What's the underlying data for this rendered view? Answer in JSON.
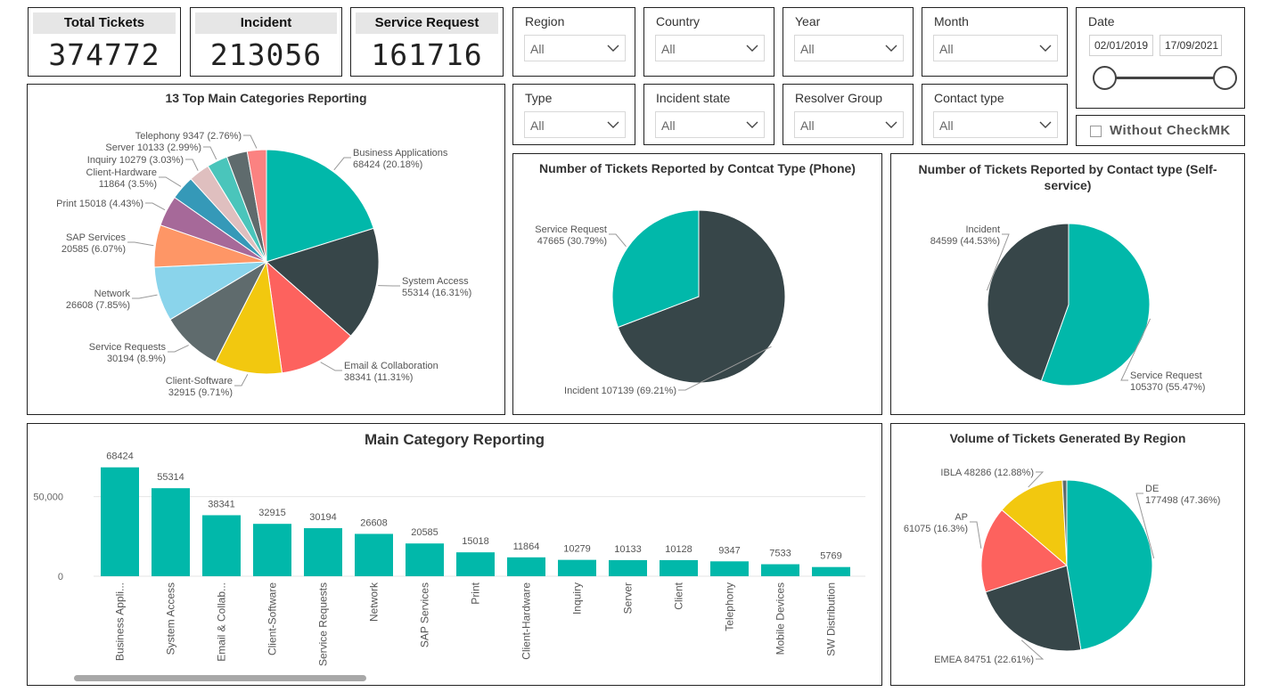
{
  "kpis": [
    {
      "label": "Total  Tickets",
      "value": "374772"
    },
    {
      "label": "Incident",
      "value": "213056"
    },
    {
      "label": "Service Request",
      "value": "161716"
    }
  ],
  "slicers": {
    "region": {
      "label": "Region",
      "value": "All"
    },
    "country": {
      "label": "Country",
      "value": "All"
    },
    "year": {
      "label": "Year",
      "value": "All"
    },
    "month": {
      "label": "Month",
      "value": "All"
    },
    "type": {
      "label": "Type",
      "value": "All"
    },
    "incident_state": {
      "label": "Incident state",
      "value": "All"
    },
    "resolver_group": {
      "label": "Resolver Group",
      "value": "All"
    },
    "contact_type": {
      "label": "Contact type",
      "value": "All"
    }
  },
  "date_slicer": {
    "label": "Date",
    "start": "02/01/2019",
    "end": "17/09/2021",
    "range_fraction": [
      0,
      1
    ]
  },
  "checkbox": {
    "label": "Without CheckMK",
    "checked": false
  },
  "colors": {
    "teal": "#01B8AA",
    "dark": "#374649",
    "red": "#FD625E",
    "yellow": "#F2C80F",
    "gray": "#5F6B6D",
    "lightblue": "#8AD4EB",
    "orange": "#FE9666",
    "purple": "#A66999",
    "blue": "#3599B8",
    "pink": "#DFBFBF",
    "turquoise": "#4AC5BB",
    "darkgray": "#5F6B6D",
    "salmon": "#FB8281"
  },
  "chart_data": [
    {
      "id": "top-categories",
      "type": "pie",
      "title": "13 Top Main Categories Reporting",
      "slices": [
        {
          "label": "Business Applications",
          "value": 68424,
          "pct": "20.18%",
          "color": "#01B8AA"
        },
        {
          "label": "System Access",
          "value": 55314,
          "pct": "16.31%",
          "color": "#374649"
        },
        {
          "label": "Email & Collaboration",
          "value": 38341,
          "pct": "11.31%",
          "color": "#FD625E"
        },
        {
          "label": "Client-Software",
          "value": 32915,
          "pct": "9.71%",
          "color": "#F2C80F"
        },
        {
          "label": "Service Requests",
          "value": 30194,
          "pct": "8.9%",
          "color": "#5F6B6D"
        },
        {
          "label": "Network",
          "value": 26608,
          "pct": "7.85%",
          "color": "#8AD4EB"
        },
        {
          "label": "SAP Services",
          "value": 20585,
          "pct": "6.07%",
          "color": "#FE9666"
        },
        {
          "label": "Print",
          "value": 15018,
          "pct": "4.43%",
          "color": "#A66999"
        },
        {
          "label": "Client-Hardware",
          "value": 11864,
          "pct": "3.5%",
          "color": "#3599B8"
        },
        {
          "label": "Inquiry",
          "value": 10279,
          "pct": "3.03%",
          "color": "#DFBFBF"
        },
        {
          "label": "Server",
          "value": 10133,
          "pct": "2.99%",
          "color": "#4AC5BB"
        },
        {
          "label": "Client",
          "value": 10128,
          "pct": "",
          "color": "#5F6B6D"
        },
        {
          "label": "Telephony",
          "value": 9347,
          "pct": "2.76%",
          "color": "#FB8281"
        }
      ]
    },
    {
      "id": "phone",
      "type": "pie",
      "title": "Number of Tickets Reported by Contcat Type (Phone)",
      "slices": [
        {
          "label": "Incident",
          "value": 107139,
          "pct": "69.21%",
          "color": "#374649"
        },
        {
          "label": "Service Request",
          "value": 47665,
          "pct": "30.79%",
          "color": "#01B8AA"
        }
      ]
    },
    {
      "id": "self-service",
      "type": "pie",
      "title": "Number of Tickets Reported by Contact type (Self-service)",
      "slices": [
        {
          "label": "Service Request",
          "value": 105370,
          "pct": "55.47%",
          "color": "#01B8AA"
        },
        {
          "label": "Incident",
          "value": 84599,
          "pct": "44.53%",
          "color": "#374649"
        }
      ]
    },
    {
      "id": "main-category",
      "type": "bar",
      "title": "Main Category Reporting",
      "categories": [
        "Business Appli...",
        "System Access",
        "Email & Collab...",
        "Client-Software",
        "Service Requests",
        "Network",
        "SAP Services",
        "Print",
        "Client-Hardware",
        "Inquiry",
        "Server",
        "Client",
        "Telephony",
        "Mobile Devices",
        "SW Distribution"
      ],
      "values": [
        68424,
        55314,
        38341,
        32915,
        30194,
        26608,
        20585,
        15018,
        11864,
        10279,
        10133,
        10128,
        9347,
        7533,
        5769
      ],
      "yticks": [
        "0",
        "50,000"
      ],
      "ytick_values": [
        0,
        50000
      ],
      "ylim": [
        0,
        75000
      ],
      "color": "#01B8AA",
      "grid": true
    },
    {
      "id": "region",
      "type": "pie",
      "title": "Volume of Tickets Generated By Region",
      "slices": [
        {
          "label": "DE",
          "value": 177498,
          "pct": "47.36%",
          "color": "#01B8AA"
        },
        {
          "label": "EMEA",
          "value": 84751,
          "pct": "22.61%",
          "color": "#374649"
        },
        {
          "label": "AP",
          "value": 61075,
          "pct": "16.3%",
          "color": "#FD625E"
        },
        {
          "label": "IBLA",
          "value": 48286,
          "pct": "12.88%",
          "color": "#F2C80F"
        },
        {
          "label": "",
          "value": 3162,
          "pct": "",
          "color": "#5F6B6D"
        }
      ]
    }
  ]
}
